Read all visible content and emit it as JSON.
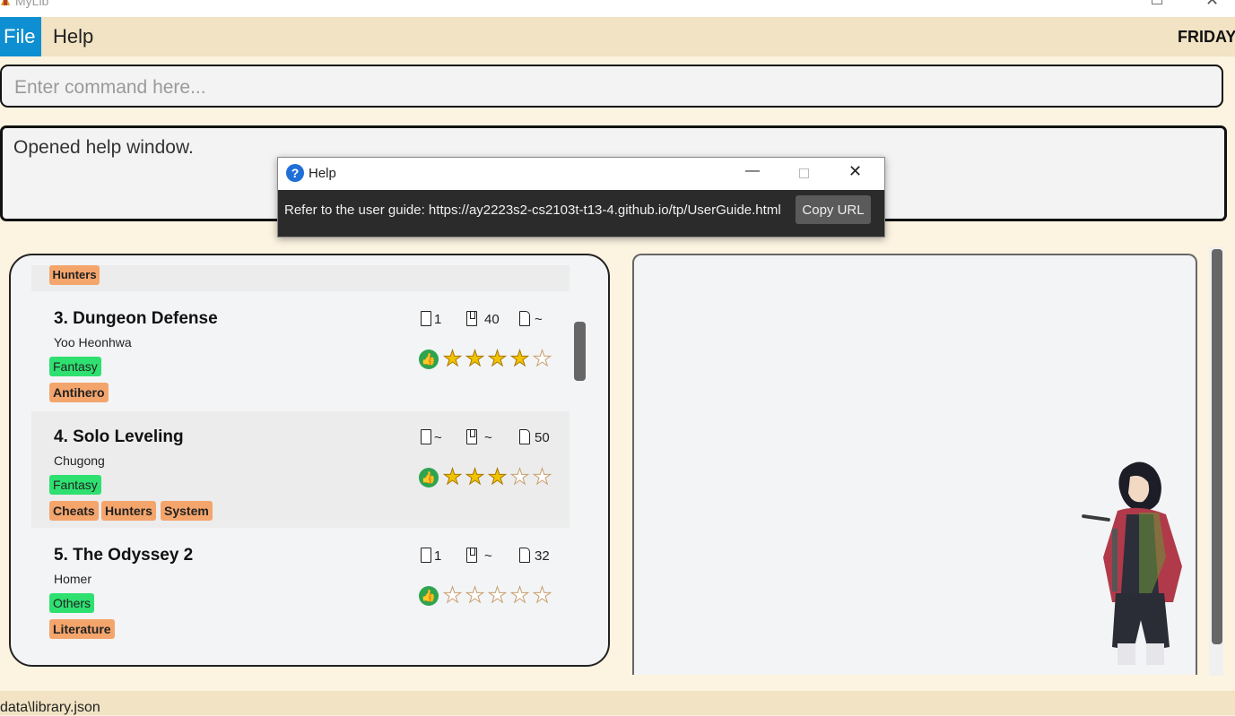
{
  "window": {
    "title": "MyLib"
  },
  "menu": {
    "file": "File",
    "help": "Help"
  },
  "day": "FRIDAY",
  "command": {
    "placeholder": "Enter command here...",
    "value": ""
  },
  "result": {
    "text": "Opened help window."
  },
  "list": {
    "partial_tag": "Hunters",
    "cards": [
      {
        "title": "3. Dungeon Defense",
        "author": "Yoo Heonhwa",
        "genre": "Fantasy",
        "tags": [
          "Antihero"
        ],
        "progress": {
          "volume": "1",
          "chapter": "40",
          "episode": "~"
        },
        "rating": 4,
        "rating_max": 5
      },
      {
        "title": "4. Solo Leveling",
        "author": "Chugong",
        "genre": "Fantasy",
        "tags": [
          "Cheats",
          "Hunters",
          "System"
        ],
        "progress": {
          "volume": "~",
          "chapter": "~",
          "episode": "50"
        },
        "rating": 3,
        "rating_max": 5
      },
      {
        "title": "5. The Odyssey 2",
        "author": "Homer",
        "genre": "Others",
        "tags": [
          "Literature"
        ],
        "progress": {
          "volume": "1",
          "chapter": "~",
          "episode": "32"
        },
        "rating": 0,
        "rating_max": 5
      }
    ]
  },
  "help_popup": {
    "title": "Help",
    "message": "Refer to the user guide: https://ay2223s2-cs2103t-t13-4.github.io/tp/UserGuide.html",
    "button": "Copy URL"
  },
  "status": {
    "path": "data\\library.json"
  },
  "colors": {
    "accent": "#0e8fd1",
    "menu_bg": "#f1e3c3",
    "genre_tag": "#2ee070",
    "other_tag": "#f4a56c"
  }
}
